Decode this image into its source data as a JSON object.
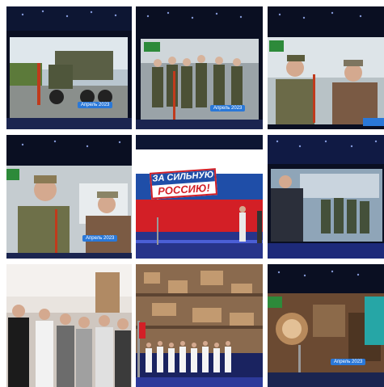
{
  "collage": {
    "tiles": [
      {
        "caption": "Апрель 2023"
      },
      {
        "caption": "Апрель 2023"
      },
      {
        "caption": ""
      },
      {
        "caption": "Апрель 2023"
      },
      {
        "banner_line1": "ЗА СИЛЬНУЮ",
        "banner_line2": "РОССИЮ!"
      },
      {
        "caption": ""
      },
      {
        "caption": ""
      },
      {
        "caption": ""
      },
      {
        "caption": "Апрель 2023"
      }
    ]
  },
  "colors": {
    "led_dark": "#0b1020",
    "caption_blue": "#2a78d8",
    "flag_white": "#ffffff",
    "flag_blue": "#1f4ea8",
    "flag_red": "#d31f26"
  }
}
